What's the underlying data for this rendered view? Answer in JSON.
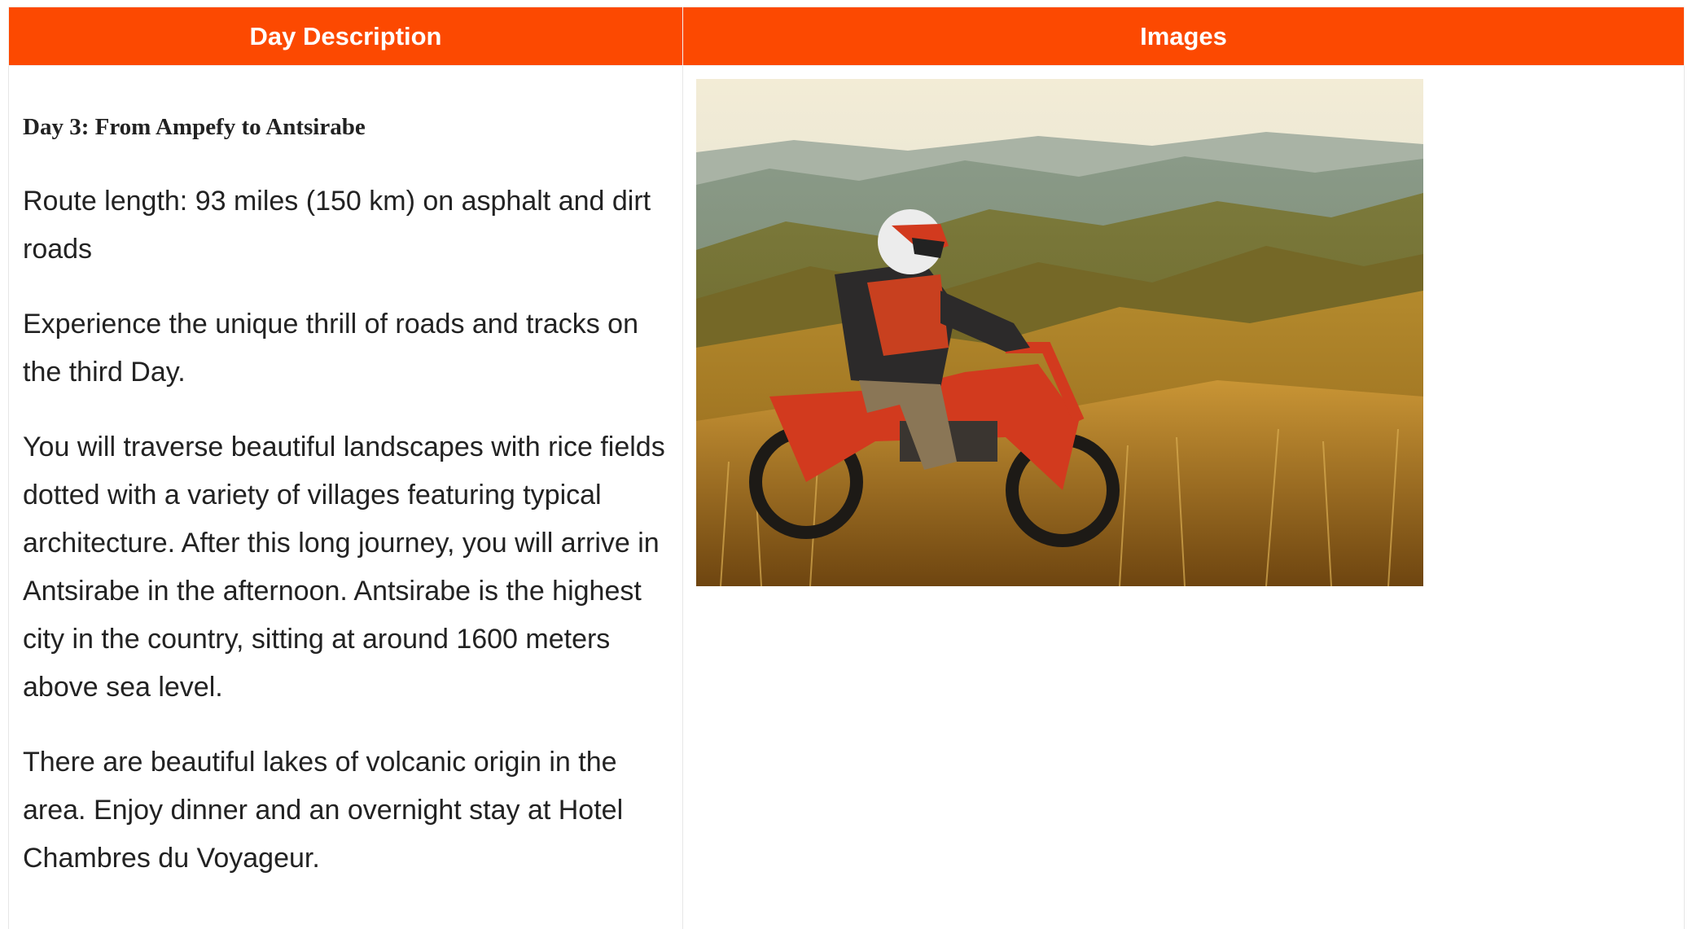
{
  "table": {
    "headers": [
      "Day Description",
      "Images"
    ]
  },
  "day": {
    "title": "Day 3: From Ampefy to Antsirabe",
    "paragraphs": [
      "Route length: 93 miles (150 km) on asphalt and dirt roads",
      "Experience the unique thrill of roads and tracks on the third Day.",
      "You will traverse beautiful landscapes with rice fields dotted with a variety of villages featuring typical architecture. After this long journey, you will arrive in Antsirabe in the afternoon. Antsirabe is the highest city in the country, sitting at around 1600 meters above sea level.",
      "There are beautiful lakes of volcanic origin in the area. Enjoy dinner and an overnight stay at Hotel Chambres du Voyageur."
    ]
  },
  "colors": {
    "header_bg": "#fc4901",
    "header_text": "#ffffff",
    "body_text": "#222222"
  }
}
